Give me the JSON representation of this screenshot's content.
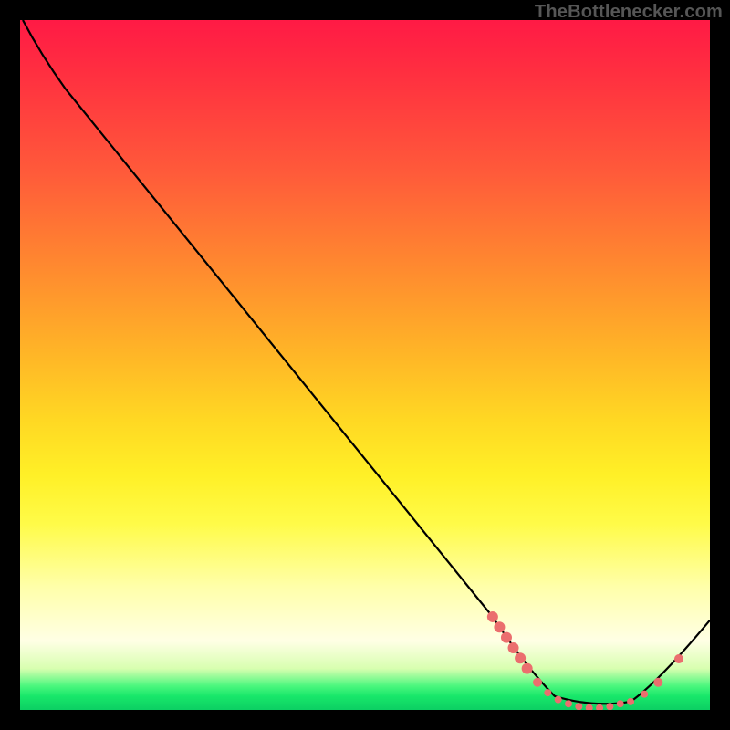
{
  "attribution": "TheBottlenecker.com",
  "chart_data": {
    "type": "line",
    "title": "",
    "xlabel": "",
    "ylabel": "",
    "xlim": [
      0,
      100
    ],
    "ylim": [
      0,
      100
    ],
    "series": [
      {
        "name": "curve",
        "points": [
          {
            "x": 0.4,
            "y": 100.0
          },
          {
            "x": 3.0,
            "y": 95.0
          },
          {
            "x": 6.6,
            "y": 90.0
          },
          {
            "x": 68.5,
            "y": 13.5
          },
          {
            "x": 73.5,
            "y": 6.0
          },
          {
            "x": 77.5,
            "y": 2.0
          },
          {
            "x": 83.0,
            "y": 0.3
          },
          {
            "x": 88.5,
            "y": 1.2
          },
          {
            "x": 92.5,
            "y": 4.0
          },
          {
            "x": 100.0,
            "y": 13.0
          }
        ]
      }
    ],
    "markers": [
      {
        "x": 68.5,
        "y": 13.5,
        "r": 6
      },
      {
        "x": 69.5,
        "y": 12.0,
        "r": 6
      },
      {
        "x": 70.5,
        "y": 10.5,
        "r": 6
      },
      {
        "x": 71.5,
        "y": 9.0,
        "r": 6
      },
      {
        "x": 72.5,
        "y": 7.5,
        "r": 6
      },
      {
        "x": 73.5,
        "y": 6.0,
        "r": 6
      },
      {
        "x": 75.0,
        "y": 4.0,
        "r": 5
      },
      {
        "x": 76.5,
        "y": 2.5,
        "r": 4
      },
      {
        "x": 78.0,
        "y": 1.5,
        "r": 4
      },
      {
        "x": 79.5,
        "y": 0.9,
        "r": 4
      },
      {
        "x": 81.0,
        "y": 0.5,
        "r": 4
      },
      {
        "x": 82.5,
        "y": 0.3,
        "r": 4
      },
      {
        "x": 84.0,
        "y": 0.3,
        "r": 4
      },
      {
        "x": 85.5,
        "y": 0.5,
        "r": 4
      },
      {
        "x": 87.0,
        "y": 0.9,
        "r": 4
      },
      {
        "x": 88.5,
        "y": 1.2,
        "r": 4
      },
      {
        "x": 90.5,
        "y": 2.3,
        "r": 4
      },
      {
        "x": 92.5,
        "y": 4.0,
        "r": 5
      },
      {
        "x": 95.5,
        "y": 7.4,
        "r": 5
      }
    ],
    "background": "red-yellow-green vertical gradient"
  }
}
